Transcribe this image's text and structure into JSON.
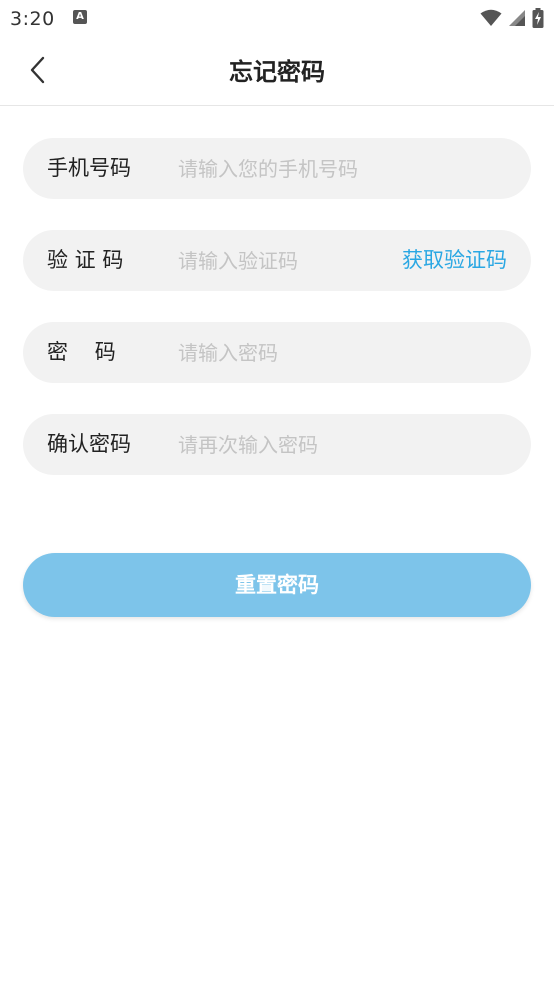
{
  "status_bar": {
    "time": "3:20",
    "notification_icon": "a-letter-icon",
    "icons": [
      "wifi-icon",
      "signal-icon",
      "battery-charging-icon"
    ]
  },
  "app_bar": {
    "back_icon": "chevron-left-icon",
    "title": "忘记密码"
  },
  "form": {
    "phone": {
      "label": "手机号码",
      "placeholder": "请输入您的手机号码",
      "value": ""
    },
    "code": {
      "label": "验 证 码",
      "placeholder": "请输入验证码",
      "value": "",
      "action_label": "获取验证码"
    },
    "password": {
      "label": "密    码",
      "placeholder": "请输入密码",
      "value": ""
    },
    "confirm": {
      "label": "确认密码",
      "placeholder": "请再次输入密码",
      "value": ""
    }
  },
  "reset_button": {
    "label": "重置密码"
  },
  "colors": {
    "accent_link": "#2aa7e3",
    "button_bg": "#7dc4ea",
    "field_bg": "#f2f2f2",
    "placeholder": "#c4c4c4"
  }
}
